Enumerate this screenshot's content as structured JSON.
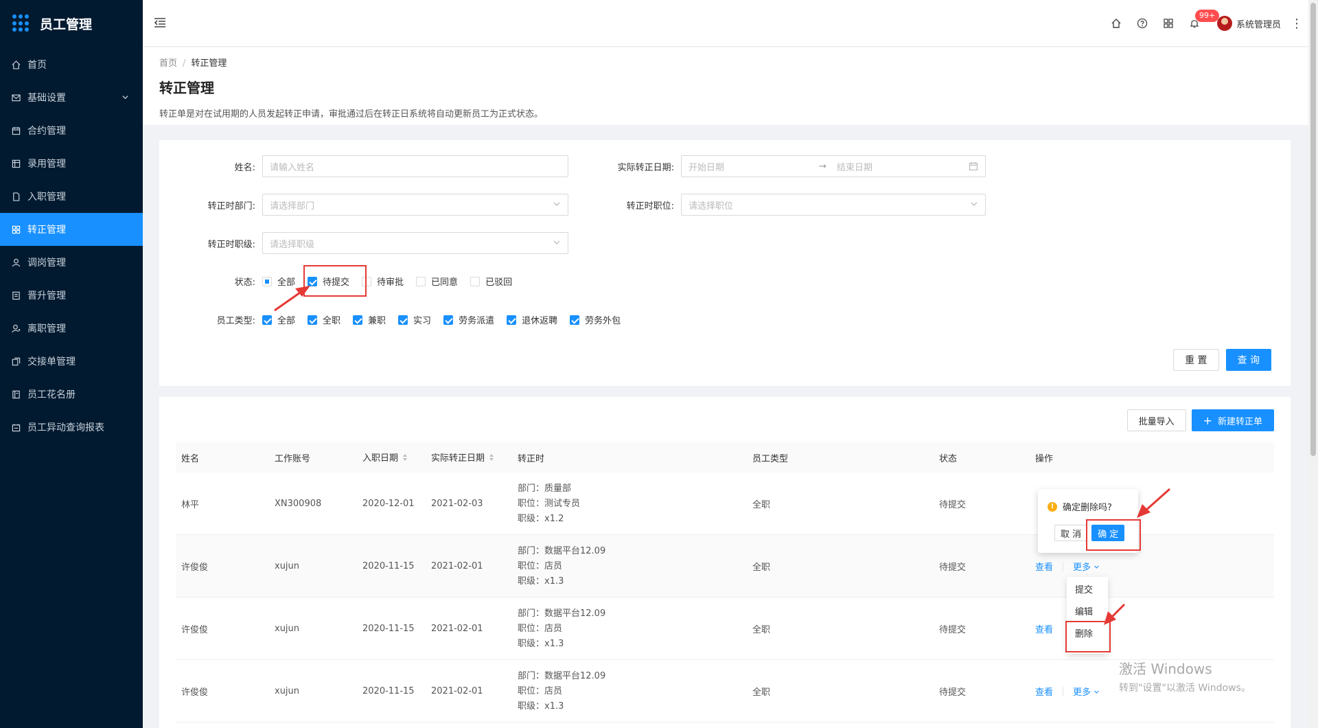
{
  "app": {
    "title": "员工管理"
  },
  "sidebar": {
    "items": [
      {
        "label": "首页",
        "icon": "home-icon"
      },
      {
        "label": "基础设置",
        "icon": "mail-icon",
        "expandable": true
      },
      {
        "label": "合约管理",
        "icon": "calendar-icon"
      },
      {
        "label": "录用管理",
        "icon": "grid-icon"
      },
      {
        "label": "入职管理",
        "icon": "file-icon"
      },
      {
        "label": "转正管理",
        "icon": "tiles-icon",
        "active": true
      },
      {
        "label": "调岗管理",
        "icon": "user-icon"
      },
      {
        "label": "晋升管理",
        "icon": "document-icon"
      },
      {
        "label": "离职管理",
        "icon": "user-leave-icon"
      },
      {
        "label": "交接单管理",
        "icon": "copy-icon"
      },
      {
        "label": "员工花名册",
        "icon": "book-icon"
      },
      {
        "label": "员工异动查询报表",
        "icon": "report-icon"
      }
    ]
  },
  "header": {
    "notification_badge": "99+",
    "user_name": "系统管理员"
  },
  "page": {
    "breadcrumb": [
      "首页",
      "转正管理"
    ],
    "title": "转正管理",
    "description": "转正单是对在试用期的人员发起转正申请，审批通过后在转正日系统将自动更新员工为正式状态。"
  },
  "filters": {
    "name": {
      "label": "姓名:",
      "placeholder": "请输入姓名"
    },
    "actual_date": {
      "label": "实际转正日期:",
      "start_placeholder": "开始日期",
      "end_placeholder": "结束日期"
    },
    "department": {
      "label": "转正时部门:",
      "placeholder": "请选择部门"
    },
    "position": {
      "label": "转正时职位:",
      "placeholder": "请选择职位"
    },
    "level": {
      "label": "转正时职级:",
      "placeholder": "请选择职级"
    },
    "status": {
      "label": "状态:",
      "options": [
        {
          "label": "全部",
          "state": "partial"
        },
        {
          "label": "待提交",
          "state": "checked"
        },
        {
          "label": "待审批",
          "state": "unchecked"
        },
        {
          "label": "已同意",
          "state": "unchecked"
        },
        {
          "label": "已驳回",
          "state": "unchecked"
        }
      ]
    },
    "employee_type": {
      "label": "员工类型:",
      "options": [
        {
          "label": "全部",
          "state": "checked"
        },
        {
          "label": "全职",
          "state": "checked"
        },
        {
          "label": "兼职",
          "state": "checked"
        },
        {
          "label": "实习",
          "state": "checked"
        },
        {
          "label": "劳务派遣",
          "state": "checked"
        },
        {
          "label": "退休返聘",
          "state": "checked"
        },
        {
          "label": "劳务外包",
          "state": "checked"
        }
      ]
    },
    "reset_label": "重 置",
    "query_label": "查 询"
  },
  "toolbar": {
    "import_label": "批量导入",
    "new_label": "新建转正单"
  },
  "table": {
    "columns": [
      "姓名",
      "工作账号",
      "入职日期",
      "实际转正日期",
      "转正时",
      "员工类型",
      "状态",
      "操作"
    ],
    "rows": [
      {
        "name": "林平",
        "account": "XN300908",
        "join_date": "2020-12-01",
        "actual_date": "2021-02-03",
        "dept": "部门：质量部",
        "pos": "职位：测试专员",
        "level": "职级：x1.2",
        "type": "全职",
        "status": "待提交"
      },
      {
        "name": "许俊俊",
        "account": "xujun",
        "join_date": "2020-11-15",
        "actual_date": "2021-02-01",
        "dept": "部门：数据平台12.09",
        "pos": "职位：店员",
        "level": "职级：x1.3",
        "type": "全职",
        "status": "待提交"
      },
      {
        "name": "许俊俊",
        "account": "xujun",
        "join_date": "2020-11-15",
        "actual_date": "2021-02-01",
        "dept": "部门：数据平台12.09",
        "pos": "职位：店员",
        "level": "职级：x1.3",
        "type": "全职",
        "status": "待提交"
      },
      {
        "name": "许俊俊",
        "account": "xujun",
        "join_date": "2020-11-15",
        "actual_date": "2021-02-01",
        "dept": "部门：数据平台12.09",
        "pos": "职位：店员",
        "level": "职级：x1.3",
        "type": "全职",
        "status": "待提交"
      }
    ],
    "view_label": "查看",
    "more_label": "更多"
  },
  "popconfirm": {
    "message": "确定删除吗?",
    "cancel_label": "取 消",
    "ok_label": "确 定"
  },
  "dropdown": {
    "items": [
      "提交",
      "编辑",
      "删除"
    ]
  },
  "watermark": {
    "line1": "激活 Windows",
    "line2": "转到\"设置\"以激活 Windows。"
  },
  "colors": {
    "primary": "#1890ff",
    "sidebar_bg": "#011a30",
    "annotation_red": "#e53935"
  }
}
